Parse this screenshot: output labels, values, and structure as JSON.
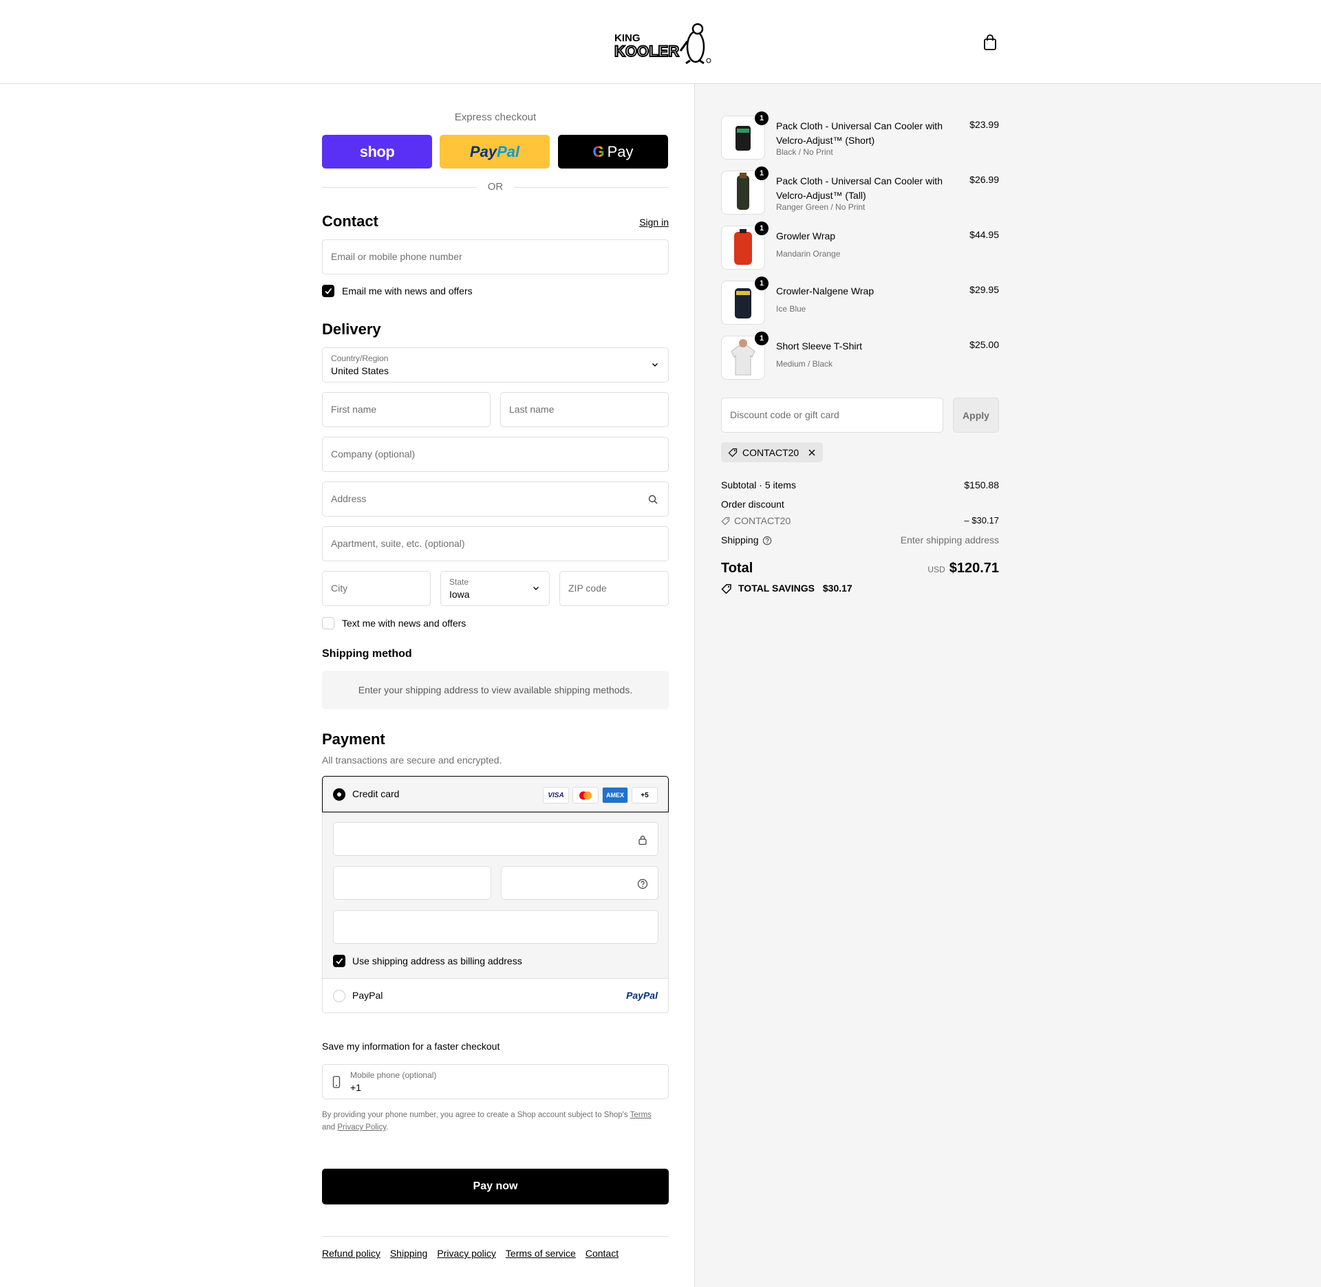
{
  "header": {
    "logo_text_top": "KING",
    "logo_text_bottom": "KOOLER",
    "cart_icon": "shopping-bag-icon"
  },
  "express": {
    "title": "Express checkout",
    "shop_label": "shop",
    "paypal_label_1": "Pay",
    "paypal_label_2": "Pal",
    "gpay_g": "G",
    "gpay_label": "Pay",
    "or_label": "OR"
  },
  "contact": {
    "title": "Contact",
    "signin": "Sign in",
    "email_placeholder": "Email or mobile phone number",
    "news_label": "Email me with news and offers"
  },
  "delivery": {
    "title": "Delivery",
    "country_label": "Country/Region",
    "country_value": "United States",
    "first_name": "First name",
    "last_name": "Last name",
    "company": "Company (optional)",
    "address": "Address",
    "apartment": "Apartment, suite, etc. (optional)",
    "city": "City",
    "state_label": "State",
    "state_value": "Iowa",
    "zip": "ZIP code",
    "text_label": "Text me with news and offers"
  },
  "shipping_method": {
    "title": "Shipping method",
    "message": "Enter your shipping address to view available shipping methods."
  },
  "payment": {
    "title": "Payment",
    "subtitle": "All transactions are secure and encrypted.",
    "credit_card_label": "Credit card",
    "card_logos": [
      "VISA",
      "",
      "AMEX",
      "+5"
    ],
    "billing_label": "Use shipping address as billing address",
    "paypal_label": "PayPal",
    "paypal_logo": "PayPal"
  },
  "save": {
    "title": "Save my information for a faster checkout",
    "phone_label": "Mobile phone (optional)",
    "phone_value": "+1",
    "legal_1": "By providing your phone number, you agree to create a Shop account subject to Shop's",
    "legal_terms": "Terms",
    "legal_and": "and",
    "legal_privacy": "Privacy Policy",
    "legal_end": "."
  },
  "pay_now": "Pay now",
  "footer": [
    "Refund policy",
    "Shipping",
    "Privacy policy",
    "Terms of service",
    "Contact"
  ],
  "summary": {
    "items": [
      {
        "qty": "1",
        "name": "Pack Cloth - Universal Can Cooler with Velcro-Adjust™ (Short)",
        "variant": "Black / No Print",
        "price": "$23.99",
        "thumb_color": "#1c1c1c"
      },
      {
        "qty": "1",
        "name": "Pack Cloth - Universal Can Cooler with Velcro-Adjust™ (Tall)",
        "variant": "Ranger Green / No Print",
        "price": "$26.99",
        "thumb_color": "#2f3524"
      },
      {
        "qty": "1",
        "name": "Growler Wrap",
        "variant": "Mandarin Orange",
        "price": "$44.95",
        "thumb_color": "#d9361c"
      },
      {
        "qty": "1",
        "name": "Crowler-Nalgene Wrap",
        "variant": "Ice Blue",
        "price": "$29.95",
        "thumb_color": "#1a2130"
      },
      {
        "qty": "1",
        "name": "Short Sleeve T-Shirt",
        "variant": "Medium / Black",
        "price": "$25.00",
        "thumb_color": "#e8e8e8"
      }
    ],
    "discount_placeholder": "Discount code or gift card",
    "apply": "Apply",
    "code": "CONTACT20",
    "subtotal_label": "Subtotal · 5 items",
    "subtotal_value": "$150.88",
    "order_discount_label": "Order discount",
    "discount_code": "CONTACT20",
    "discount_value": "– $30.17",
    "shipping_label": "Shipping",
    "shipping_value": "Enter shipping address",
    "total_label": "Total",
    "currency": "USD",
    "total_value": "$120.71",
    "savings_label": "TOTAL SAVINGS",
    "savings_value": "$30.17"
  }
}
